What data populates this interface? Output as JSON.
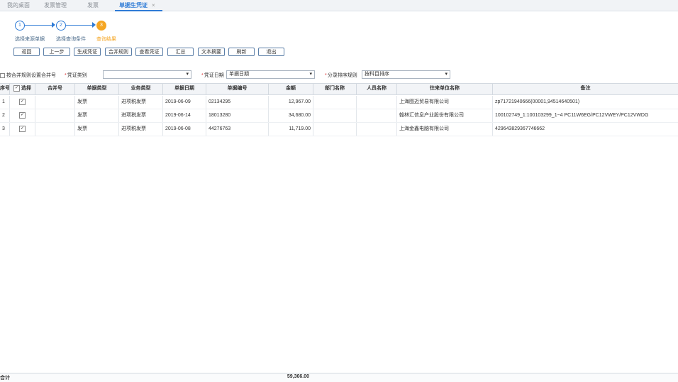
{
  "tabs": [
    {
      "label": "我的桌面"
    },
    {
      "label": "发票管理"
    },
    {
      "label": "发票"
    },
    {
      "label": "单据生凭证",
      "close": "×"
    }
  ],
  "stepper": {
    "steps": [
      {
        "num": "1",
        "label": "选择来源单据"
      },
      {
        "num": "2",
        "label": "选择查询条件"
      },
      {
        "num": "3",
        "label": "查询结果"
      }
    ]
  },
  "toolbar": {
    "back": "返回",
    "prev": "上一步",
    "generate": "生成凭证",
    "merge_rule": "合并规则",
    "view_voucher": "查看凭证",
    "summary": "汇总",
    "text_settings": "文本摘要",
    "refresh": "刷新",
    "exit": "退出"
  },
  "options": {
    "merge_label": "按合并规则设置合并号",
    "voucher_type_label": "凭证类别",
    "voucher_type_value": "",
    "voucher_date_label": "凭证日期",
    "voucher_date_value": "单据日期",
    "sort_label": "分录排序规则",
    "sort_value": "按科目排序",
    "caret": "▾"
  },
  "table": {
    "headers": {
      "seq": "序号",
      "select": "选择",
      "merge": "合并号",
      "doc_type": "单据类型",
      "biz_type": "业务类型",
      "doc_date": "单据日期",
      "doc_no": "单据编号",
      "amount": "金额",
      "dept": "部门名称",
      "person": "人员名称",
      "partner": "往来单位名称",
      "remark": "备注"
    },
    "rows": [
      {
        "seq": "1",
        "checked": "✓",
        "merge": "",
        "doc_type": "发票",
        "biz_type": "进项税发票",
        "doc_date": "2019-06-09",
        "doc_no": "02134295",
        "amount": "12,967.00",
        "dept": "",
        "person": "",
        "partner": "上海图迈贸易有限公司",
        "remark": "zp71721940666(00001,94514640501)"
      },
      {
        "seq": "2",
        "checked": "✓",
        "merge": "",
        "doc_type": "发票",
        "biz_type": "进项税发票",
        "doc_date": "2019-06-14",
        "doc_no": "18013280",
        "amount": "34,680.00",
        "dept": "",
        "person": "",
        "partner": "翰林汇信息产业股份有限公司",
        "remark": "100102749_1:100103299_1~4 PC11W6EG/PC12VWEY/PC12VWDG"
      },
      {
        "seq": "3",
        "checked": "✓",
        "merge": "",
        "doc_type": "发票",
        "biz_type": "进项税发票",
        "doc_date": "2019-06-08",
        "doc_no": "44276763",
        "amount": "11,719.00",
        "dept": "",
        "person": "",
        "partner": "上海金鑫电脑有限公司",
        "remark": "429643829367746662"
      }
    ]
  },
  "footer": {
    "label": "合计",
    "total": "59,366.00"
  },
  "colors": {
    "accent": "#2e7bd6",
    "current_step": "#f5a623"
  }
}
